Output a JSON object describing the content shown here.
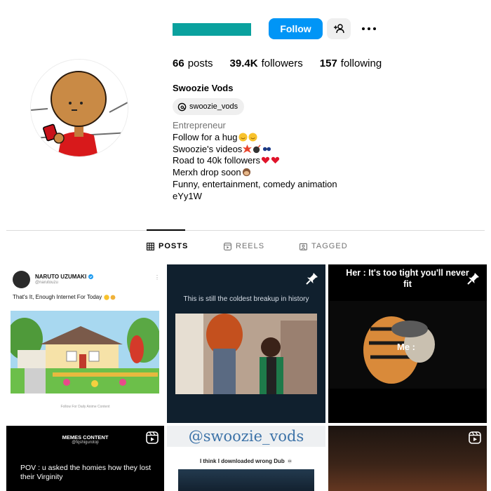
{
  "profile": {
    "follow_label": "Follow",
    "stats": [
      {
        "count": "66",
        "label": "posts"
      },
      {
        "count": "39.4K",
        "label": "followers"
      },
      {
        "count": "157",
        "label": "following"
      }
    ],
    "display_name": "Swoozie Vods",
    "threads_handle": "swoozie_vods",
    "bio": {
      "category": "Entrepreneur",
      "lines": [
        "Follow for a hug",
        "Swoozie's videos",
        "Road to 40k followers",
        "Merxh drop soon",
        "Funny, entertainment, comedy animation",
        "eYy1W"
      ]
    },
    "colors": {
      "accent": "#0095f6",
      "username_bar": "#0aa19e"
    }
  },
  "tabs": [
    {
      "label": "POSTS",
      "icon": "grid-icon",
      "active": true
    },
    {
      "label": "REELS",
      "icon": "reels-icon",
      "active": false
    },
    {
      "label": "TAGGED",
      "icon": "tagged-icon",
      "active": false
    }
  ],
  "posts": [
    {
      "type": "tweet",
      "pinned": false,
      "author": "NARUTO UZUMAKI",
      "handle": "@narutouzu",
      "text": "That's It, Enough Internet For Today",
      "caption": "Follow For Daily Anime Content"
    },
    {
      "type": "image",
      "pinned": true,
      "caption": "This is still the coldest breakup in history"
    },
    {
      "type": "reel",
      "pinned": true,
      "caption": "Her : It's too tight you'll never fit",
      "overlay": "Me :"
    },
    {
      "type": "reel",
      "header": "MEMES CONTENT",
      "handle": "@fqshigurotoji",
      "caption": "POV : u asked the homies how they lost their Virginity"
    },
    {
      "type": "image",
      "header": "@swoozie_vods",
      "caption": "I think I downloaded wrong Dub"
    },
    {
      "type": "reel"
    }
  ]
}
